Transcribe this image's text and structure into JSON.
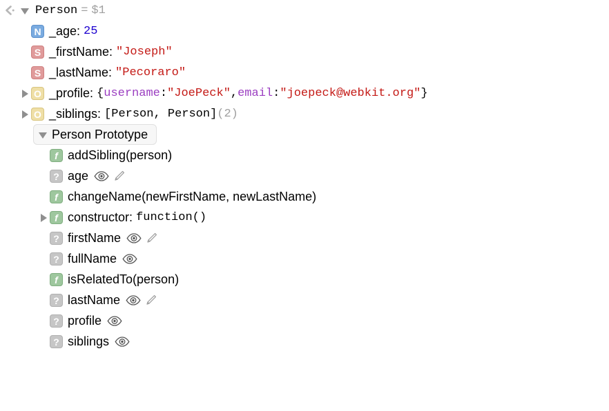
{
  "panel": {
    "name": "object-tree",
    "root": {
      "goto_icon": "goto-arrow-icon",
      "disclosure": "disclosure-triangle-open",
      "name": "Person",
      "equals": "=",
      "handle": "$1"
    },
    "properties": [
      {
        "icon": "number-badge-icon",
        "badge": "N",
        "badge_type": "number",
        "name": "_age:",
        "value": "25",
        "value_type": "number",
        "expandable": false
      },
      {
        "icon": "string-badge-icon",
        "badge": "S",
        "badge_type": "string",
        "name": "_firstName:",
        "value": "\"Joseph\"",
        "value_type": "string",
        "expandable": false
      },
      {
        "icon": "string-badge-icon",
        "badge": "S",
        "badge_type": "string",
        "name": "_lastName:",
        "value": "\"Pecoraro\"",
        "value_type": "string",
        "expandable": false
      },
      {
        "icon": "object-badge-icon",
        "badge": "O",
        "badge_type": "object",
        "name": "_profile:",
        "expandable": true,
        "value_parts": [
          {
            "text": "{",
            "style": "plain"
          },
          {
            "text": "username",
            "style": "key"
          },
          {
            "text": ": ",
            "style": "plain"
          },
          {
            "text": "\"JoePeck\"",
            "style": "string"
          },
          {
            "text": ", ",
            "style": "plain"
          },
          {
            "text": "email",
            "style": "key"
          },
          {
            "text": ": ",
            "style": "plain"
          },
          {
            "text": "\"joepeck@webkit.org\"",
            "style": "string"
          },
          {
            "text": "}",
            "style": "plain"
          }
        ]
      },
      {
        "icon": "object-badge-icon",
        "badge": "O",
        "badge_type": "object",
        "name": "_siblings:",
        "expandable": true,
        "value_parts": [
          {
            "text": "[Person, Person]",
            "style": "plain"
          },
          {
            "text": "  (2)",
            "style": "dim"
          }
        ]
      }
    ],
    "prototype_section": {
      "disclosure": "disclosure-triangle-open",
      "label": "Person Prototype"
    },
    "prototype_members": [
      {
        "icon": "function-badge-icon",
        "badge": "f",
        "badge_type": "function",
        "name": "addSibling(person)",
        "expandable": false,
        "getter": false,
        "setter": false
      },
      {
        "icon": "unknown-badge-icon",
        "badge": "?",
        "badge_type": "unknown",
        "name": "age",
        "expandable": false,
        "getter": true,
        "setter": true
      },
      {
        "icon": "function-badge-icon",
        "badge": "f",
        "badge_type": "function",
        "name": "changeName(newFirstName, newLastName)",
        "expandable": false,
        "getter": false,
        "setter": false
      },
      {
        "icon": "function-badge-icon",
        "badge": "f",
        "badge_type": "function",
        "name": "constructor:",
        "value": "function()",
        "value_type": "mono",
        "expandable": true,
        "getter": false,
        "setter": false
      },
      {
        "icon": "unknown-badge-icon",
        "badge": "?",
        "badge_type": "unknown",
        "name": "firstName",
        "expandable": false,
        "getter": true,
        "setter": true
      },
      {
        "icon": "unknown-badge-icon",
        "badge": "?",
        "badge_type": "unknown",
        "name": "fullName",
        "expandable": false,
        "getter": true,
        "setter": false
      },
      {
        "icon": "function-badge-icon",
        "badge": "f",
        "badge_type": "function",
        "name": "isRelatedTo(person)",
        "expandable": false,
        "getter": false,
        "setter": false
      },
      {
        "icon": "unknown-badge-icon",
        "badge": "?",
        "badge_type": "unknown",
        "name": "lastName",
        "expandable": false,
        "getter": true,
        "setter": true
      },
      {
        "icon": "unknown-badge-icon",
        "badge": "?",
        "badge_type": "unknown",
        "name": "profile",
        "expandable": false,
        "getter": true,
        "setter": false
      },
      {
        "icon": "unknown-badge-icon",
        "badge": "?",
        "badge_type": "unknown",
        "name": "siblings",
        "expandable": false,
        "getter": true,
        "setter": false
      }
    ],
    "colors": {
      "string": "#c41a16",
      "number": "#1c00cf",
      "key": "#9b3ec1",
      "dim": "#a0a0a0",
      "badge_number": "#7aabe0",
      "badge_string": "#e09b9b",
      "badge_object": "#efdfa6",
      "badge_function": "#9ec79e",
      "badge_unknown": "#c6c6c6"
    }
  }
}
